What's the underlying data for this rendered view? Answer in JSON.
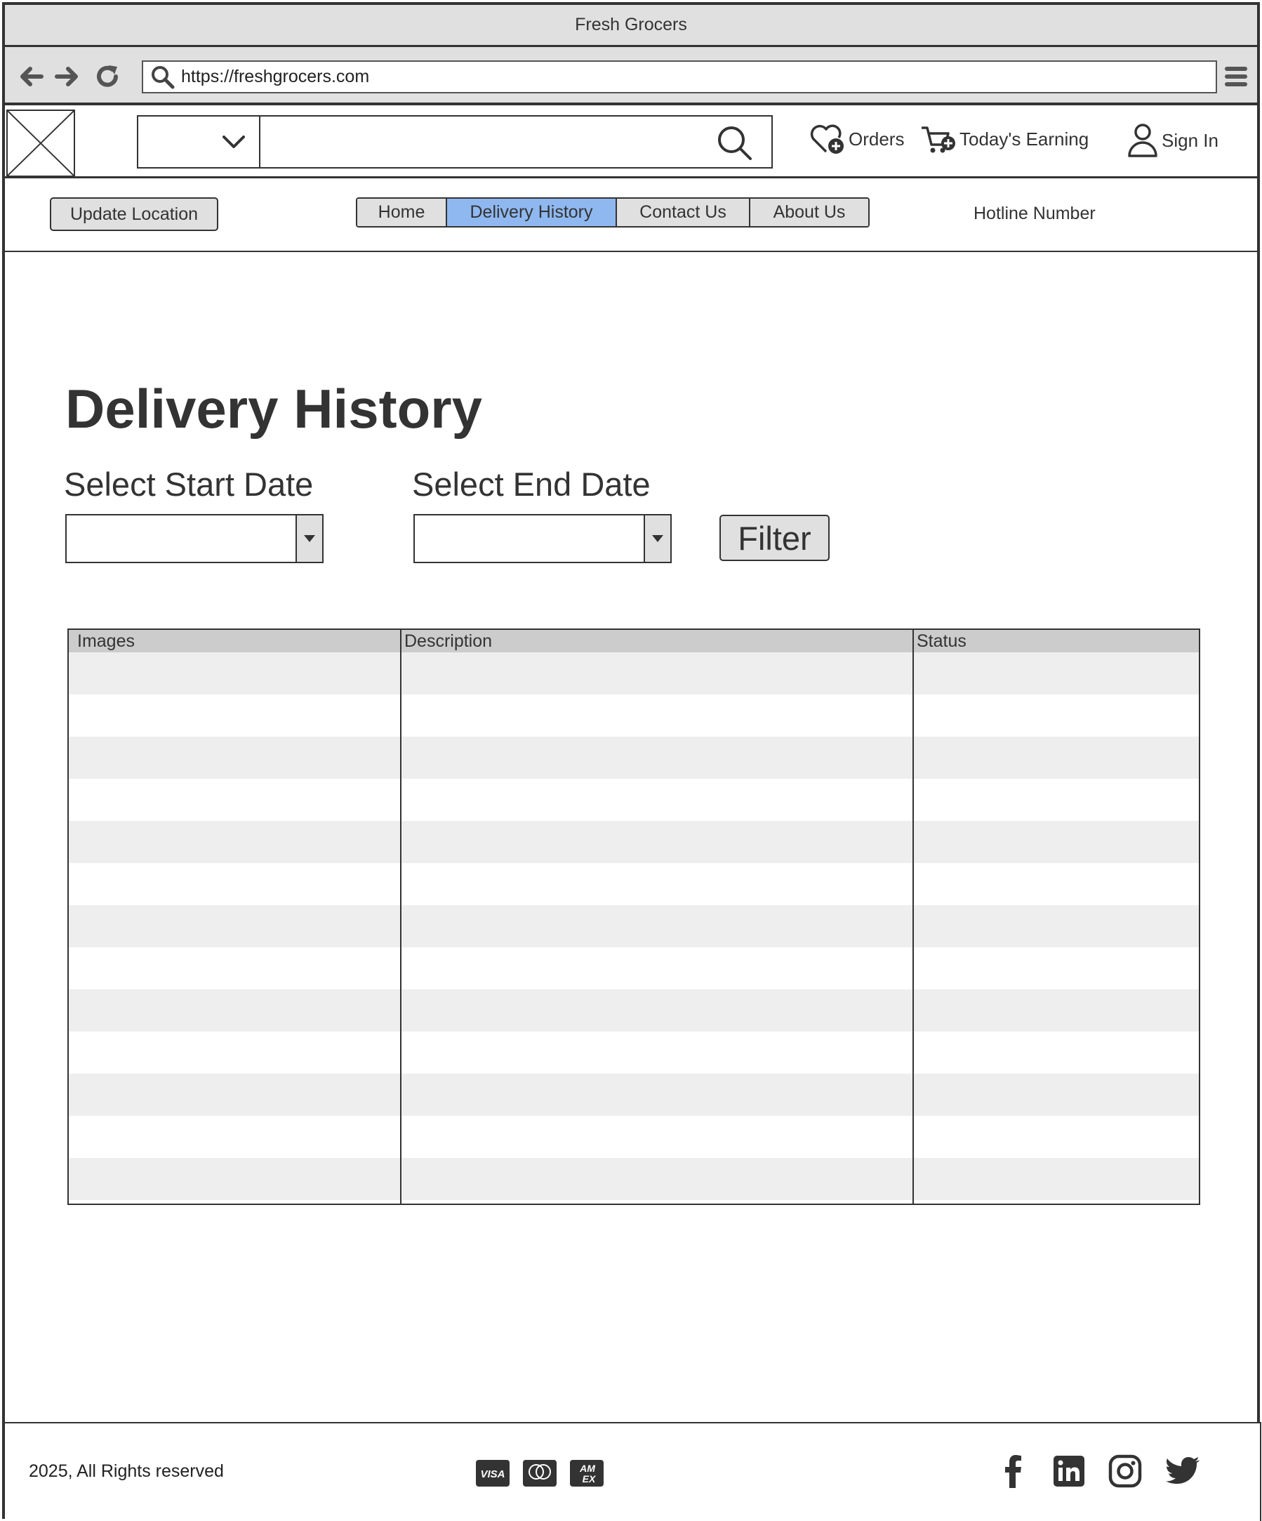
{
  "window": {
    "title": "Fresh Grocers"
  },
  "browser": {
    "url": "https://freshgrocers.com"
  },
  "header": {
    "orders_label": "Orders",
    "earning_label": "Today's Earning",
    "signin_label": "Sign In"
  },
  "subnav": {
    "location_button": "Update Location",
    "tabs": [
      {
        "label": "Home",
        "active": false
      },
      {
        "label": "Delivery History",
        "active": true
      },
      {
        "label": "Contact Us",
        "active": false
      },
      {
        "label": "About Us",
        "active": false
      }
    ],
    "hotline": "Hotline Number"
  },
  "main": {
    "title": "Delivery History",
    "start_date_label": "Select Start Date",
    "end_date_label": "Select End Date",
    "filter_button": "Filter",
    "table": {
      "columns": [
        "Images",
        "Description",
        "Status"
      ]
    }
  },
  "footer": {
    "copyright": "2025, All Rights reserved",
    "payment_icons": [
      "visa-icon",
      "mastercard-icon",
      "amex-icon"
    ],
    "social_icons": [
      "facebook-icon",
      "linkedin-icon",
      "instagram-icon",
      "twitter-icon"
    ]
  },
  "colors": {
    "active_tab": "#8fb8f0",
    "chrome": "#e0e0e0",
    "stroke": "#333333",
    "row_stripe": "#eeeeee",
    "table_header": "#cccccc"
  }
}
